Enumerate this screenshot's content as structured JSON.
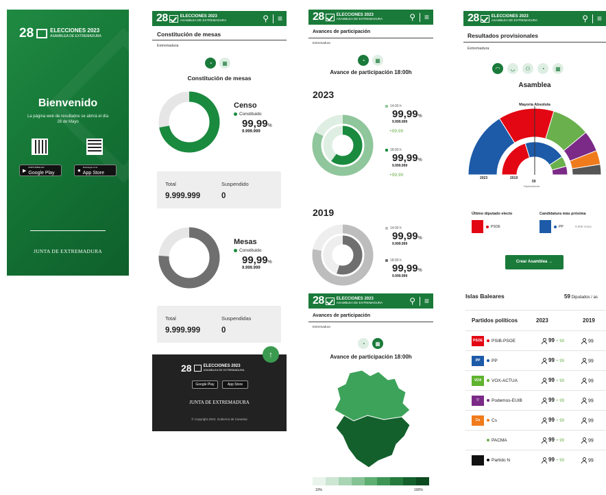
{
  "brand": {
    "number": "28",
    "line1": "ELECCIONES 2023",
    "line2": "ASAMBLEA DE EXTREMADURA"
  },
  "icons": {
    "search": "search-icon",
    "menu": "hamburger-menu-icon",
    "up": "arrow-up-icon",
    "check": "ballot-check-icon"
  },
  "colors": {
    "primary": "#1a7a3a",
    "accent": "#3a9a4f",
    "dark": "#222222"
  },
  "splash": {
    "title": "Bienvenido",
    "message": "La página web de resultados se abrirá el día 28 de Mayo",
    "google_play": "Google Play",
    "google_play_top": "DISPONIBLE EN",
    "app_store": "App Store",
    "app_store_top": "Descargar en la",
    "footer": "JUNTA DE EXTREMADURA"
  },
  "mesas": {
    "section": "Constitución de mesas",
    "region": "Extremadura",
    "subtitle": "Constitución de mesas",
    "censo": {
      "title": "Censo",
      "legend": "Constituido",
      "pct": "99,99",
      "unit": "%",
      "num": "9.999.999",
      "total_label": "Total",
      "total_value": "9.999.999",
      "susp_label": "Suspendido",
      "susp_value": "0",
      "fraction": 0.72
    },
    "mesas": {
      "title": "Mesas",
      "legend": "Constituido",
      "pct": "99,99",
      "unit": "%",
      "num": "9.999.999",
      "total_label": "Total",
      "total_value": "9.999.999",
      "susp_label": "Suspendidas",
      "susp_value": "0",
      "fraction": 0.76
    },
    "footer": {
      "google_play": "Google Play",
      "app_store": "App Store",
      "junta": "JUNTA DE EXTREMADURA",
      "copyright": "© Copyright 2023. Gobierno de Canarias"
    }
  },
  "participacion": {
    "section": "Avances de participación",
    "region": "Extremadura",
    "subtitle": "Avance de participación 18:00h",
    "y2023": {
      "year": "2023",
      "t1": "14:00 h",
      "p1": "99,99",
      "n1": "9.999.999",
      "d1": "+99,99",
      "t2": "18:00 h",
      "p2": "99,99",
      "n2": "9.999.999",
      "d2": "+99,99",
      "unit": "%",
      "outer": 0.82,
      "inner": 0.6
    },
    "y2019": {
      "year": "2019",
      "t1": "14:00 h",
      "p1": "99,99",
      "n1": "9.999.999",
      "t2": "18:00 h",
      "p2": "99,99",
      "n2": "9.999.999",
      "unit": "%",
      "outer": 0.78,
      "inner": 0.55
    },
    "map": {
      "section": "Avances de participación",
      "region": "Extremadura",
      "subtitle": "Avance de participación 18:00h",
      "legend_min": "10%",
      "legend_max": "100%"
    }
  },
  "resultados": {
    "section": "Resultados provisionales",
    "region": "Extremadura",
    "title": "Asamblea",
    "majority": "Mayoría Absoluta",
    "label_2023": "2023",
    "label_2019": "2019",
    "seats_total": "59",
    "seats_label": "Diputados/as",
    "last_elected": "Último diputado electo",
    "next_candidate": "Candidatura más próxima",
    "last_party": "PSOE",
    "next_party": "PP",
    "next_votes": "9.999 Votos",
    "create_btn": "Crear Asamblea →",
    "region_title": "Islas Baleares",
    "region_seats": "59",
    "region_seats_label": "Diputados / as",
    "col_party": "Partidos políticos",
    "col_2023": "2023",
    "col_2019": "2019",
    "parties": [
      {
        "name": "PSIB-PSOE",
        "logo": "PSOE",
        "color": "#e30613",
        "dot": "#e30613",
        "v23": "99",
        "d23": "+ 99",
        "v19": "99"
      },
      {
        "name": "PP",
        "logo": "PP",
        "color": "#1d5aa8",
        "dot": "#1d5aa8",
        "v23": "99",
        "d23": "+ 99",
        "v19": "99"
      },
      {
        "name": "VOX-ACTUA",
        "logo": "VOX",
        "color": "#5fb32f",
        "dot": "#5fb32f",
        "v23": "99",
        "d23": "+ 99",
        "v19": "99"
      },
      {
        "name": "Podemos-EUIB",
        "logo": "♡",
        "color": "#7b2a87",
        "dot": "#7b2a87",
        "v23": "99",
        "d23": "+ 99",
        "v19": "99"
      },
      {
        "name": "Cs",
        "logo": "Cs",
        "color": "#f07b1d",
        "dot": "#f07b1d",
        "v23": "99",
        "d23": "+ 99",
        "v19": "99"
      },
      {
        "name": "PACMA",
        "logo": "",
        "color": "#ffffff",
        "dot": "#6ab04c",
        "v23": "99",
        "d23": "+ 99",
        "v19": "99"
      },
      {
        "name": "Partido N",
        "logo": "",
        "color": "#111111",
        "dot": "#111111",
        "v23": "99",
        "d23": "+ 99",
        "v19": "99"
      }
    ],
    "hemicycle": {
      "outer": [
        {
          "color": "#1d5aa8",
          "seats": 19
        },
        {
          "color": "#e30613",
          "seats": 16
        },
        {
          "color": "#6ab04c",
          "seats": 11
        },
        {
          "color": "#7b2a87",
          "seats": 6
        },
        {
          "color": "#f07b1d",
          "seats": 4
        },
        {
          "color": "#555555",
          "seats": 3
        }
      ],
      "inner": [
        {
          "color": "#e30613",
          "seats": 24
        },
        {
          "color": "#1d5aa8",
          "seats": 24
        },
        {
          "color": "#6ab04c",
          "seats": 6
        },
        {
          "color": "#7b2a87",
          "seats": 5
        }
      ]
    }
  }
}
